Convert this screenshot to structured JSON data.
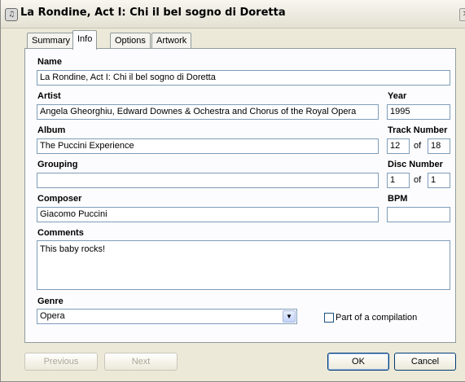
{
  "window": {
    "title": "La Rondine, Act I: Chi il bel sogno di Doretta"
  },
  "tabs": [
    {
      "label": "Summary",
      "active": false
    },
    {
      "label": "Info",
      "active": true
    },
    {
      "label": "Options",
      "active": false
    },
    {
      "label": "Artwork",
      "active": false
    }
  ],
  "info": {
    "name": {
      "label": "Name",
      "value": "La Rondine, Act I: Chi il bel sogno di Doretta"
    },
    "artist": {
      "label": "Artist",
      "value": "Angela Gheorghiu, Edward Downes & Ochestra and Chorus of the Royal Opera"
    },
    "year": {
      "label": "Year",
      "value": "1995"
    },
    "album": {
      "label": "Album",
      "value": "The Puccini Experience"
    },
    "track_number": {
      "label": "Track Number",
      "value": "12",
      "of_label": "of",
      "total": "18"
    },
    "grouping": {
      "label": "Grouping",
      "value": ""
    },
    "disc_number": {
      "label": "Disc Number",
      "value": "1",
      "of_label": "of",
      "total": "1"
    },
    "composer": {
      "label": "Composer",
      "value": "Giacomo Puccini"
    },
    "bpm": {
      "label": "BPM",
      "value": ""
    },
    "comments": {
      "label": "Comments",
      "value": "This baby rocks!"
    },
    "genre": {
      "label": "Genre",
      "value": "Opera"
    },
    "compilation": {
      "label": "Part of a compilation",
      "checked": false
    }
  },
  "buttons": {
    "previous": "Previous",
    "next": "Next",
    "ok": "OK",
    "cancel": "Cancel"
  }
}
